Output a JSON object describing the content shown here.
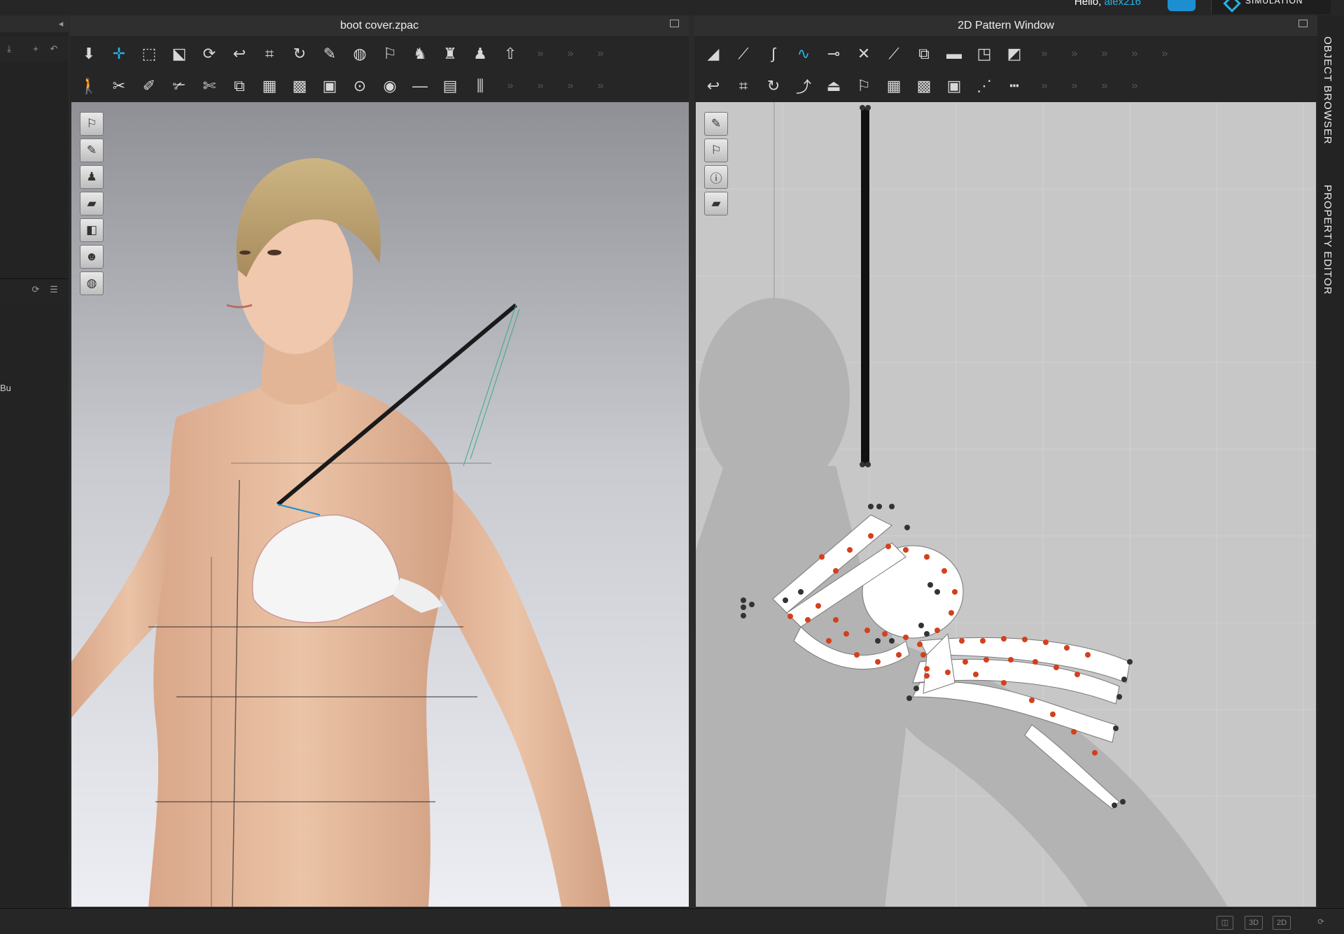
{
  "header": {
    "greeting_prefix": "Hello,",
    "username": "alex216",
    "mode_label": "SIMULATION"
  },
  "left_panel": {
    "fragment_text": "Bu"
  },
  "window_3d": {
    "title": "boot cover.zpac"
  },
  "window_2d": {
    "title": "2D Pattern Window"
  },
  "right_tabs": {
    "object_browser": "OBJECT BROWSER",
    "property_editor": "PROPERTY EDITOR"
  },
  "bottom_bar": {
    "btn_3d": "3D",
    "btn_2d": "2D"
  },
  "colors": {
    "accent": "#26b3e8",
    "point_red": "#d4401c",
    "point_dark": "#333333"
  }
}
